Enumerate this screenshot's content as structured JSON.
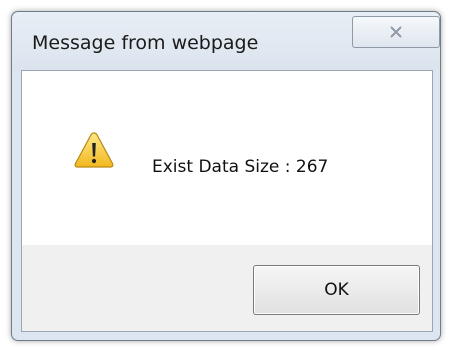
{
  "dialog": {
    "title": "Message from webpage",
    "close_icon": "close-icon",
    "message": "Exist Data Size : 267",
    "icon": "warning-icon",
    "ok_label": "OK"
  },
  "colors": {
    "frame": "#dde6f0",
    "body": "#f0f0f0",
    "message_area": "#ffffff",
    "warning_yellow": "#f2c12e"
  }
}
